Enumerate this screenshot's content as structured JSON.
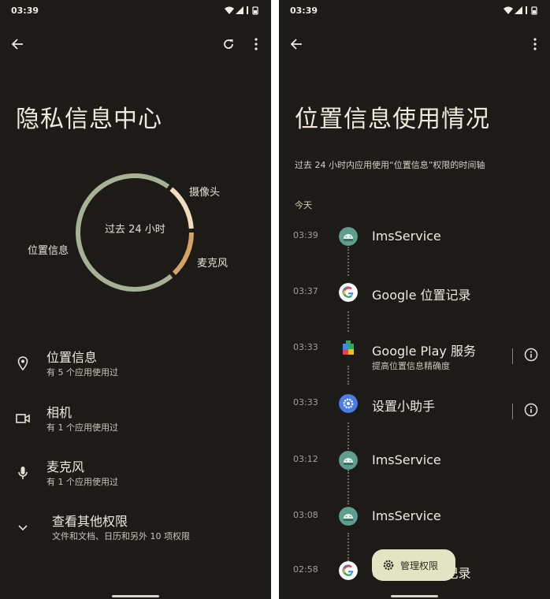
{
  "left_screen": {
    "status_time": "03:39",
    "page_title": "隐私信息中心",
    "donut": {
      "center_label": "过去 24 小时",
      "labels": {
        "location": "位置信息",
        "camera": "摄像头",
        "mic": "麦克风"
      },
      "colors": {
        "location": "#a7b194",
        "camera": "#f2dcc0",
        "mic": "#d4a466"
      }
    },
    "permissions": [
      {
        "title": "位置信息",
        "subtitle": "有 5 个应用使用过",
        "icon": "location-pin-icon"
      },
      {
        "title": "相机",
        "subtitle": "有 1 个应用使用过",
        "icon": "video-camera-icon"
      },
      {
        "title": "麦克风",
        "subtitle": "有 1 个应用使用过",
        "icon": "microphone-icon"
      }
    ],
    "more": {
      "title": "查看其他权限",
      "subtitle": "文件和文档、日历和另外 10 项权限"
    }
  },
  "right_screen": {
    "status_time": "03:39",
    "page_title": "位置信息使用情况",
    "subtitle": "过去 24 小时内应用使用“位置信息”权限的时间轴",
    "section_today": "今天",
    "timeline": [
      {
        "time": "03:39",
        "app": "ImsService",
        "subtitle": "",
        "icon": "android-icon",
        "info": false
      },
      {
        "time": "03:37",
        "app": "Google 位置记录",
        "subtitle": "",
        "icon": "google-g-icon",
        "info": false
      },
      {
        "time": "03:33",
        "app": "Google Play 服务",
        "subtitle": "提高位置信息精确度",
        "icon": "play-services-icon",
        "info": true
      },
      {
        "time": "03:33",
        "app": "设置小助手",
        "subtitle": "",
        "icon": "settings-gear-icon",
        "info": true
      },
      {
        "time": "03:12",
        "app": "ImsService",
        "subtitle": "",
        "icon": "android-icon",
        "info": false
      },
      {
        "time": "03:08",
        "app": "ImsService",
        "subtitle": "",
        "icon": "android-icon",
        "info": false
      },
      {
        "time": "02:58",
        "app": "Google 位置记录",
        "subtitle": "",
        "icon": "google-g-icon",
        "info": false
      }
    ],
    "fab_label": "管理权限"
  }
}
